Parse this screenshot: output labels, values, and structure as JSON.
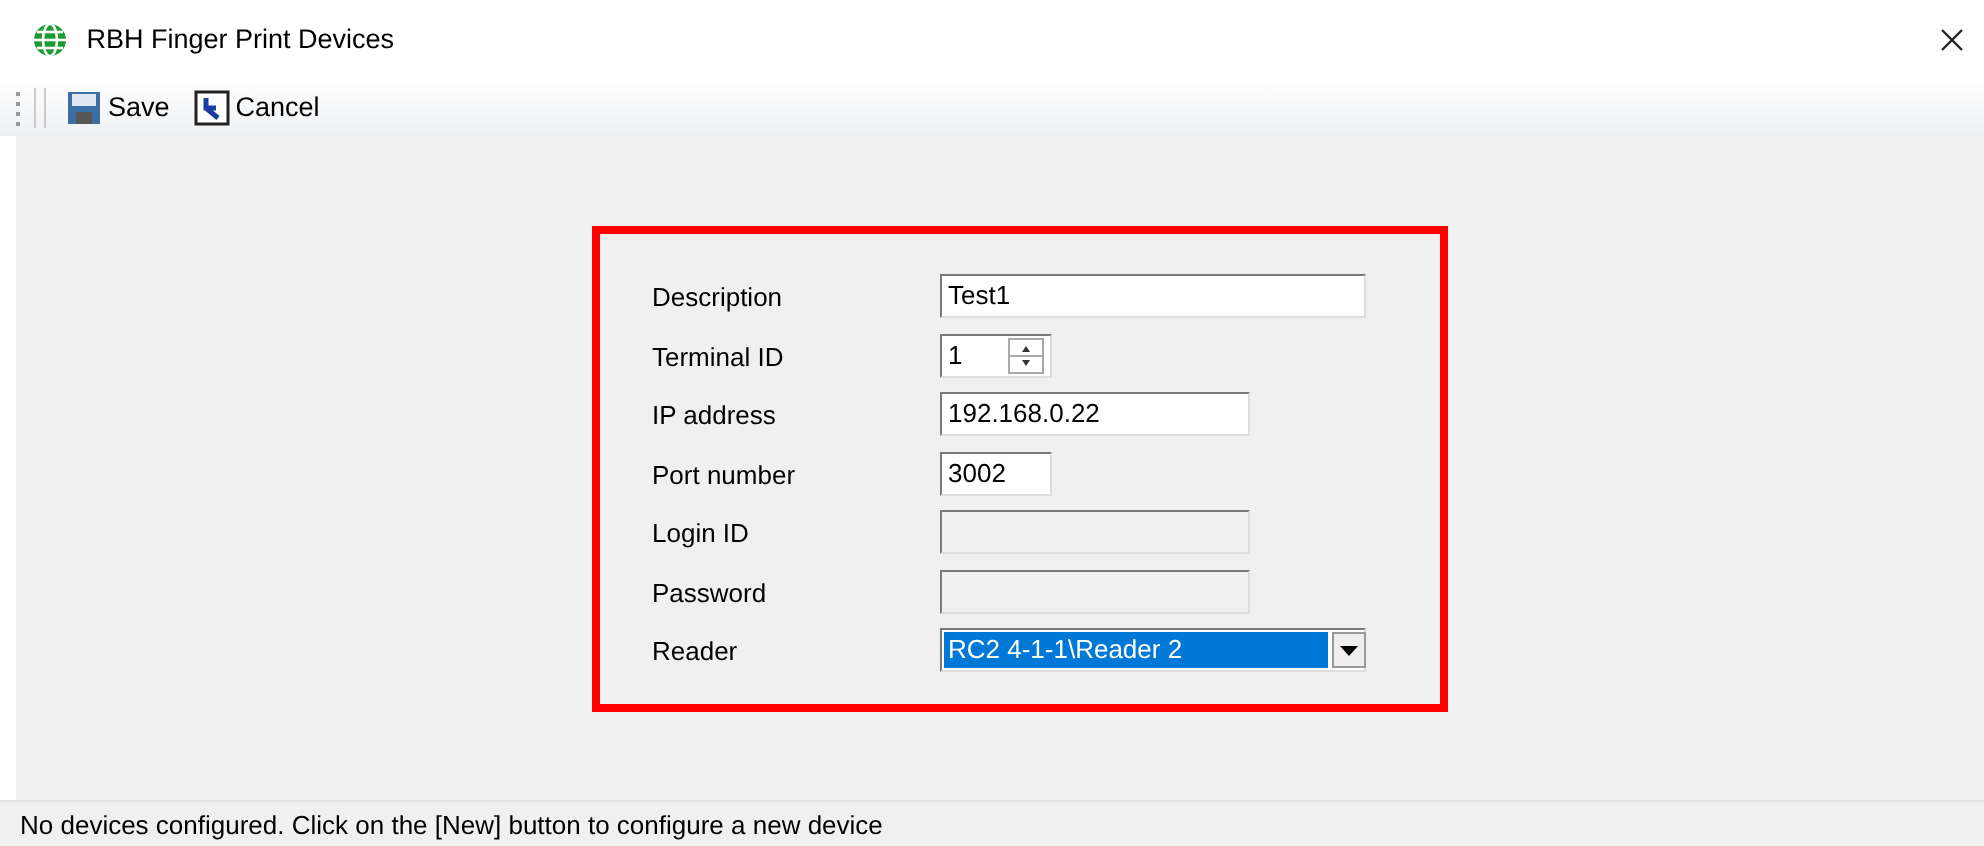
{
  "window": {
    "title": "RBH Finger Print Devices"
  },
  "toolbar": [
    {
      "label": "Save",
      "kind": "save"
    },
    {
      "label": "Cancel",
      "kind": "cancel"
    }
  ],
  "form": {
    "highlighted": true,
    "fields": [
      {
        "label": "Description",
        "kind": "text",
        "value": "Test1",
        "disabled": false
      },
      {
        "label": "Terminal ID",
        "kind": "spinner",
        "value": "1",
        "disabled": false
      },
      {
        "label": "IP address",
        "kind": "text",
        "value": "192.168.0.22",
        "disabled": false
      },
      {
        "label": "Port number",
        "kind": "text",
        "value": "3002",
        "disabled": false
      },
      {
        "label": "Login ID",
        "kind": "text",
        "disabled": true
      },
      {
        "label": "Password",
        "kind": "text",
        "disabled": true
      },
      {
        "label": "Reader",
        "kind": "select",
        "value": "RC2 4-1-1\\Reader 2",
        "disabled": false,
        "selected": true
      }
    ]
  },
  "status_bar": "No devices configured. Click on the [New] button to configure a new device"
}
